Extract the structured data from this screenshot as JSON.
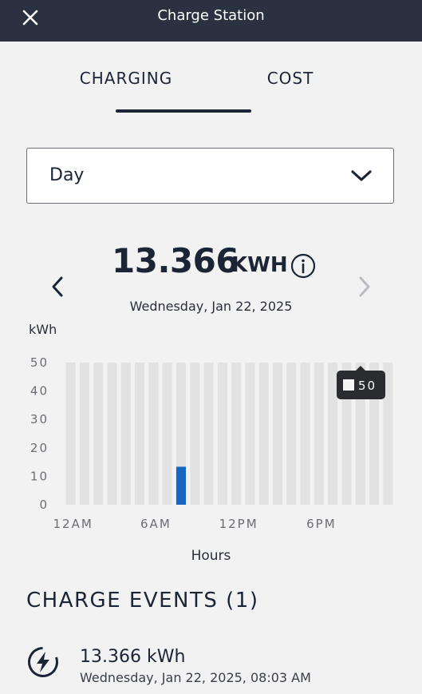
{
  "header": {
    "title": "Charge Station",
    "close_icon": "close-icon"
  },
  "tabs": [
    {
      "label": "CHARGING",
      "active": true
    },
    {
      "label": "COST",
      "active": false
    }
  ],
  "period_select": {
    "value": "Day",
    "icon": "chevron-down-icon"
  },
  "summary": {
    "total_value": "13.366",
    "total_unit": "KWH",
    "info_icon": "info-icon",
    "date": "Wednesday, Jan 22, 2025",
    "prev_icon": "chevron-left-icon",
    "next_icon": "chevron-right-icon",
    "next_enabled": false
  },
  "chart_data": {
    "type": "bar",
    "ylabel": "kWh",
    "xlabel": "Hours",
    "ylim": [
      0,
      50
    ],
    "y_ticks": [
      "50",
      "40",
      "30",
      "20",
      "10",
      "0"
    ],
    "x_tick_labels": [
      "12AM",
      "6AM",
      "12PM",
      "6PM"
    ],
    "categories": [
      "0",
      "1",
      "2",
      "3",
      "4",
      "5",
      "6",
      "7",
      "8",
      "9",
      "10",
      "11",
      "12",
      "13",
      "14",
      "15",
      "16",
      "17",
      "18",
      "19",
      "20",
      "21",
      "22",
      "23"
    ],
    "values": [
      0,
      0,
      0,
      0,
      0,
      0,
      0,
      0,
      13.366,
      0,
      0,
      0,
      0,
      0,
      0,
      0,
      0,
      0,
      0,
      0,
      0,
      0,
      0,
      0
    ],
    "tooltip": {
      "value": "50"
    },
    "colors": {
      "bar": "#1766c0",
      "track": "#e2e2e2",
      "tooltip_bg": "#2a2c30"
    }
  },
  "events": {
    "heading": "CHARGE EVENTS (1)",
    "items": [
      {
        "icon": "charging-bolt-icon",
        "kwh": "13.366 kWh",
        "time": "Wednesday, Jan 22, 2025, 08:03 AM"
      }
    ]
  },
  "colors": {
    "header_bg": "#2a3140",
    "page_bg": "#f2f2f3",
    "text_primary": "#1b2536",
    "accent": "#1766c0"
  }
}
